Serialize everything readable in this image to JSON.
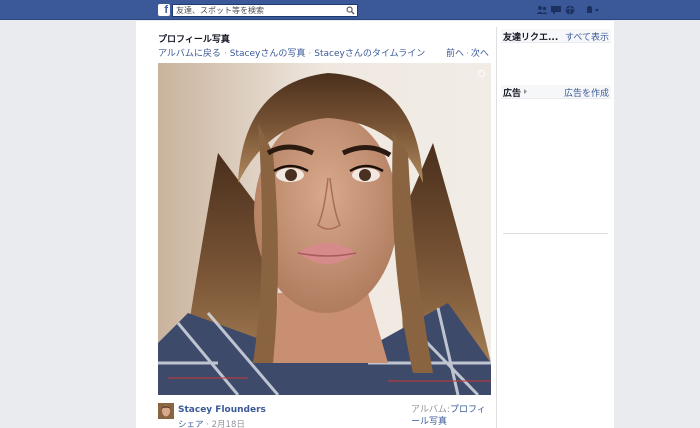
{
  "topbar": {
    "search": {
      "placeholder": "友達、スポット等を検索"
    },
    "icons": [
      "friends-icon",
      "messages-icon",
      "notifications-icon",
      "settings-icon"
    ]
  },
  "photo_page": {
    "title": "プロフィール写真",
    "breadcrumbs": [
      "アルバムに戻る",
      "Staceyさんの写真",
      "Staceyさんのタイムライン"
    ],
    "prev_label": "前へ",
    "next_label": "次へ"
  },
  "post": {
    "owner_name": "Stacey Flounders",
    "share_label": "シェア",
    "date": "2月18日",
    "album_prefix": "アルバム:",
    "album_name": "プロフィール写真"
  },
  "sidebar": {
    "friend_requests_title": "友達リクエ...",
    "see_all_label": "すべて表示",
    "ads_title": "広告",
    "create_ad_label": "広告を作成"
  },
  "colors": {
    "brand": "#3b5998",
    "link": "#3b5998",
    "muted": "#90949c",
    "background": "#e9ebee"
  }
}
